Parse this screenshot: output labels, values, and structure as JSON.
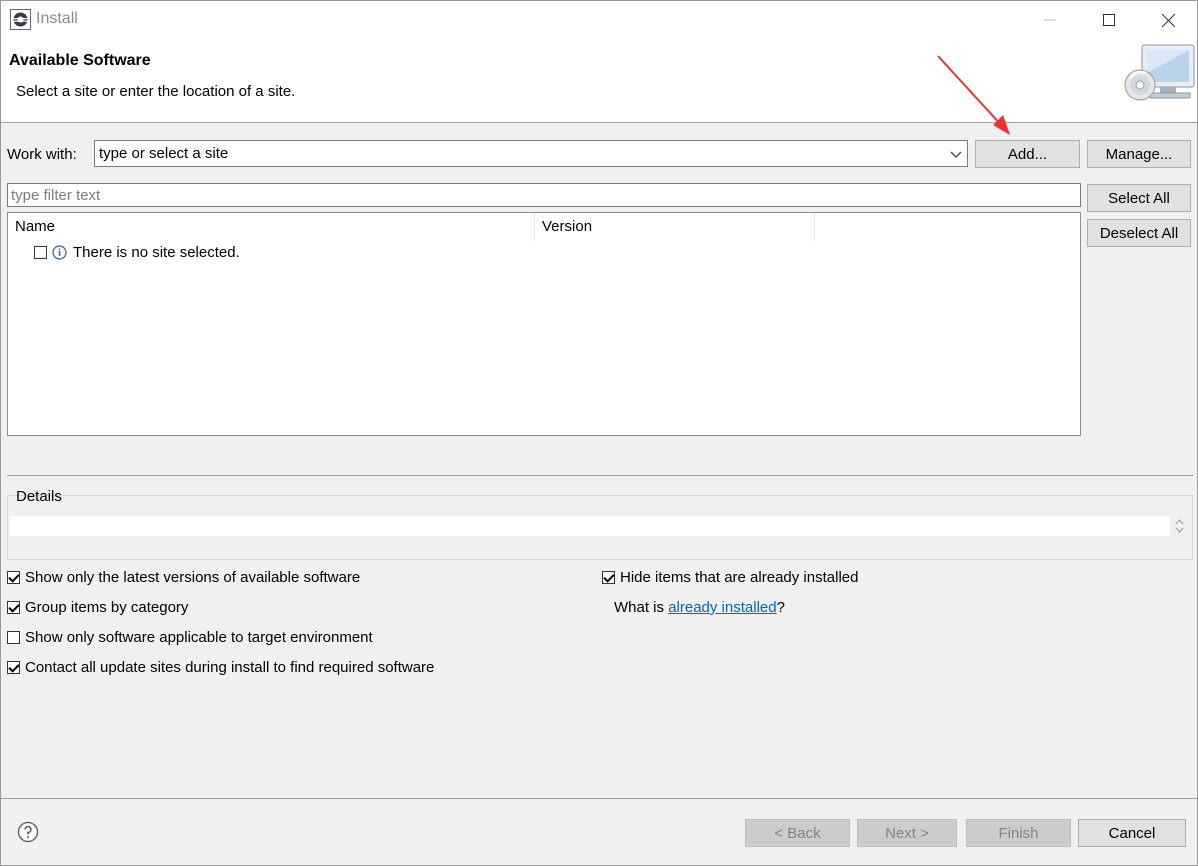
{
  "window": {
    "title": "Install"
  },
  "banner": {
    "title": "Available Software",
    "subtitle": "Select a site or enter the location of a site."
  },
  "work_with": {
    "label": "Work with:",
    "combo_value": "type or select a site",
    "add_label": "Add...",
    "manage_label": "Manage..."
  },
  "filter": {
    "placeholder": "type filter text"
  },
  "side_buttons": {
    "select_all": "Select All",
    "deselect_all": "Deselect All"
  },
  "table": {
    "columns": [
      "Name",
      "Version"
    ],
    "rows": [
      {
        "text": "There is no site selected.",
        "checked": false,
        "icon": "info-icon"
      }
    ]
  },
  "details": {
    "label": "Details"
  },
  "options": {
    "left": [
      {
        "label": "Show only the latest versions of available software",
        "checked": true
      },
      {
        "label": "Group items by category",
        "checked": true
      },
      {
        "label": "Show only software applicable to target environment",
        "checked": false
      },
      {
        "label": "Contact all update sites during install to find required software",
        "checked": true
      }
    ],
    "hide_installed": {
      "label": "Hide items that are already installed",
      "checked": true
    },
    "what_is_prefix": "What is ",
    "what_is_link": "already installed",
    "what_is_suffix": "?"
  },
  "footer": {
    "back": "< Back",
    "next": "Next >",
    "finish": "Finish",
    "cancel": "Cancel"
  },
  "colors": {
    "link": "#0066cc",
    "annotation_arrow": "#e8322b",
    "window_bg": "#f0f0f0"
  }
}
